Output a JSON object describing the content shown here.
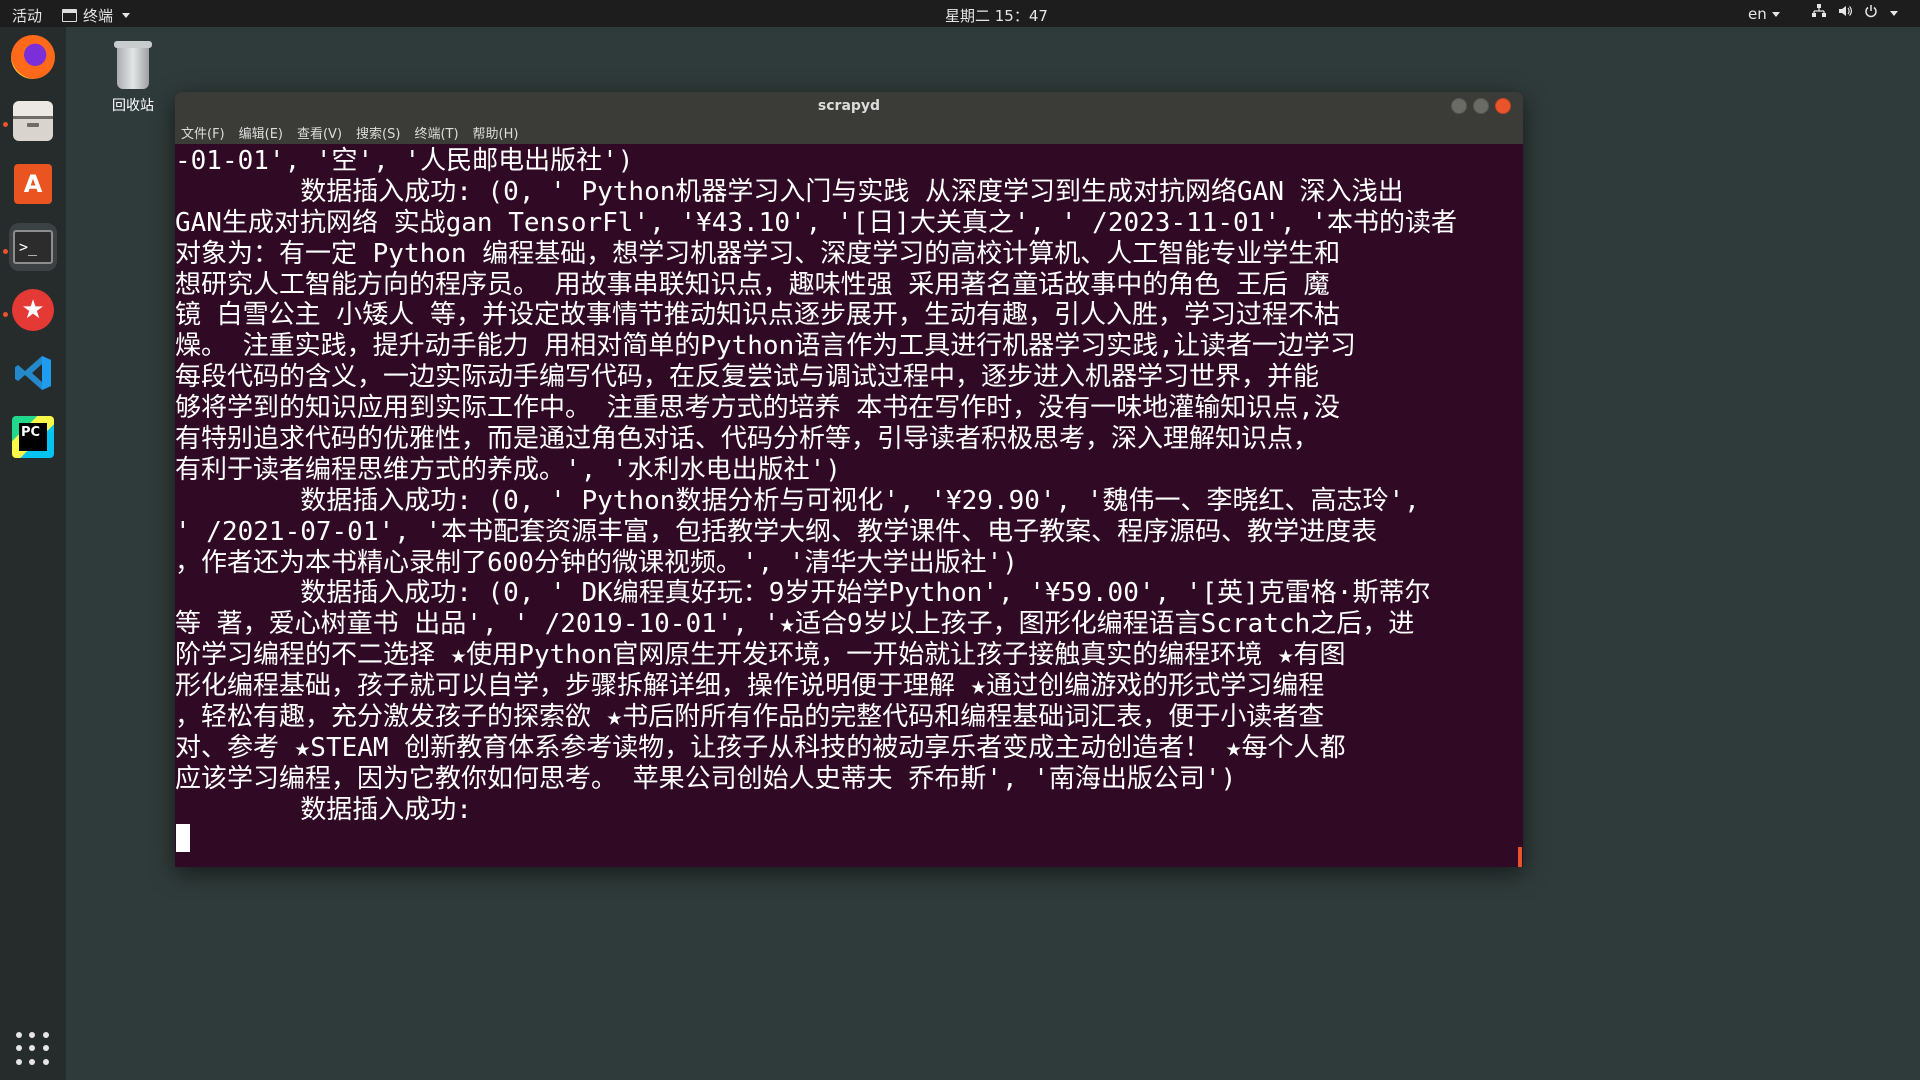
{
  "top_panel": {
    "activities": "活动",
    "app_menu": "终端",
    "clock": "星期二 15：47",
    "lang": "en"
  },
  "desktop": {
    "trash_label": "回收站"
  },
  "dock": {
    "items": [
      {
        "name": "firefox-icon"
      },
      {
        "name": "files-icon"
      },
      {
        "name": "software-store-icon"
      },
      {
        "name": "terminal-icon"
      },
      {
        "name": "postman-icon"
      },
      {
        "name": "vscode-icon"
      },
      {
        "name": "pycharm-icon"
      }
    ],
    "store_glyph": "A",
    "terminal_glyph": ">_",
    "pycharm_glyph": "PC"
  },
  "window": {
    "title": "scrapyd",
    "menu": [
      "文件(F)",
      "编辑(E)",
      "查看(V)",
      "搜索(S)",
      "终端(T)",
      "帮助(H)"
    ]
  },
  "terminal": {
    "lines": [
      "-01-01', '空', '人民邮电出版社')",
      "        数据插入成功: (0, ' Python机器学习入门与实践 从深度学习到生成对抗网络GAN 深入浅出",
      "GAN生成对抗网络 实战gan TensorFl', '¥43.10', '[日]大关真之', ' /2023-11-01', '本书的读者",
      "对象为：有一定 Python 编程基础，想学习机器学习、深度学习的高校计算机、人工智能专业学生和",
      "想研究人工智能方向的程序员。 用故事串联知识点，趣味性强 采用著名童话故事中的角色 王后 魔",
      "镜 白雪公主 小矮人 等，并设定故事情节推动知识点逐步展开，生动有趣，引人入胜，学习过程不枯",
      "燥。 注重实践，提升动手能力 用相对简单的Python语言作为工具进行机器学习实践,让读者一边学习",
      "每段代码的含义，一边实际动手编写代码，在反复尝试与调试过程中，逐步进入机器学习世界，并能",
      "够将学到的知识应用到实际工作中。 注重思考方式的培养 本书在写作时，没有一味地灌输知识点,没",
      "有特别追求代码的优雅性，而是通过角色对话、代码分析等，引导读者积极思考，深入理解知识点，",
      "有利于读者编程思维方式的养成。', '水利水电出版社')",
      "        数据插入成功: (0, ' Python数据分析与可视化', '¥29.90', '魏伟一、李晓红、高志玲',",
      "' /2021-07-01', '本书配套资源丰富，包括教学大纲、教学课件、电子教案、程序源码、教学进度表",
      "，作者还为本书精心录制了600分钟的微课视频。', '清华大学出版社')",
      "        数据插入成功: (0, ' DK编程真好玩：9岁开始学Python', '¥59.00', '[英]克雷格·斯蒂尔",
      "等 著，爱心树童书 出品', ' /2019-10-01', '★适合9岁以上孩子，图形化编程语言Scratch之后，进",
      "阶学习编程的不二选择 ★使用Python官网原生开发环境，一开始就让孩子接触真实的编程环境 ★有图",
      "形化编程基础，孩子就可以自学，步骤拆解详细，操作说明便于理解 ★通过创编游戏的形式学习编程",
      "，轻松有趣，充分激发孩子的探索欲 ★书后附所有作品的完整代码和编程基础词汇表，便于小读者查",
      "对、参考 ★STEAM 创新教育体系参考读物，让孩子从科技的被动享乐者变成主动创造者！ ★每个人都",
      "应该学习编程，因为它教你如何思考。 苹果公司创始人史蒂夫 乔布斯', '南海出版公司')",
      "        数据插入成功:"
    ]
  },
  "colors": {
    "terminal_bg": "#300a24",
    "accent": "#e9542b",
    "desktop_bg": "#2f3b3a"
  }
}
